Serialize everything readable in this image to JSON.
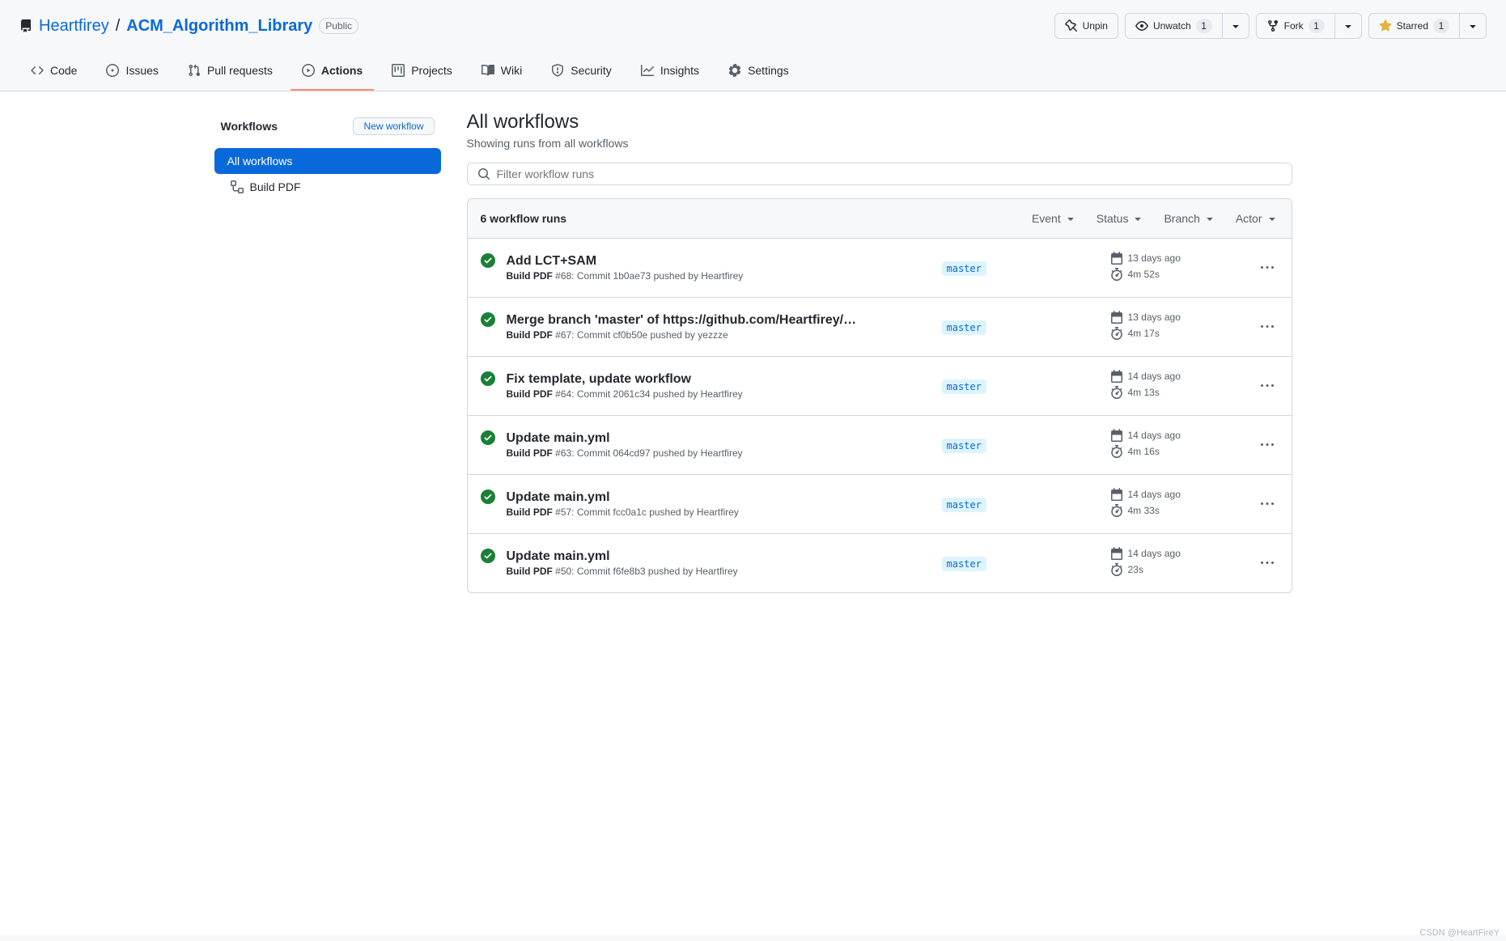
{
  "repo": {
    "owner": "Heartfirey",
    "name": "ACM_Algorithm_Library",
    "visibility": "Public"
  },
  "headerButtons": {
    "unpin": "Unpin",
    "unwatch": "Unwatch",
    "watch_count": "1",
    "fork": "Fork",
    "fork_count": "1",
    "starred": "Starred",
    "star_count": "1"
  },
  "tabs": {
    "code": "Code",
    "issues": "Issues",
    "pulls": "Pull requests",
    "actions": "Actions",
    "projects": "Projects",
    "wiki": "Wiki",
    "security": "Security",
    "insights": "Insights",
    "settings": "Settings"
  },
  "sidebar": {
    "title": "Workflows",
    "newWorkflow": "New workflow",
    "allWorkflows": "All workflows",
    "buildPdf": "Build PDF"
  },
  "page": {
    "title": "All workflows",
    "subtitle": "Showing runs from all workflows",
    "filterPlaceholder": "Filter workflow runs",
    "runsCount": "6 workflow runs",
    "filterEvent": "Event",
    "filterStatus": "Status",
    "filterBranch": "Branch",
    "filterActor": "Actor"
  },
  "runs": [
    {
      "title": "Add LCT+SAM",
      "workflow": "Build PDF",
      "num": "#68",
      "desc": "Commit 1b0ae73 pushed by Heartfirey",
      "branch": "master",
      "time": "13 days ago",
      "duration": "4m 52s"
    },
    {
      "title": "Merge branch 'master' of https://github.com/Heartfirey/…",
      "workflow": "Build PDF",
      "num": "#67",
      "desc": "Commit cf0b50e pushed by yezzze",
      "branch": "master",
      "time": "13 days ago",
      "duration": "4m 17s"
    },
    {
      "title": "Fix template, update workflow",
      "workflow": "Build PDF",
      "num": "#64",
      "desc": "Commit 2061c34 pushed by Heartfirey",
      "branch": "master",
      "time": "14 days ago",
      "duration": "4m 13s"
    },
    {
      "title": "Update main.yml",
      "workflow": "Build PDF",
      "num": "#63",
      "desc": "Commit 064cd97 pushed by Heartfirey",
      "branch": "master",
      "time": "14 days ago",
      "duration": "4m 16s"
    },
    {
      "title": "Update main.yml",
      "workflow": "Build PDF",
      "num": "#57",
      "desc": "Commit fcc0a1c pushed by Heartfirey",
      "branch": "master",
      "time": "14 days ago",
      "duration": "4m 33s"
    },
    {
      "title": "Update main.yml",
      "workflow": "Build PDF",
      "num": "#50",
      "desc": "Commit f6fe8b3 pushed by Heartfirey",
      "branch": "master",
      "time": "14 days ago",
      "duration": "23s"
    }
  ],
  "watermark": "CSDN @HeartFireY"
}
